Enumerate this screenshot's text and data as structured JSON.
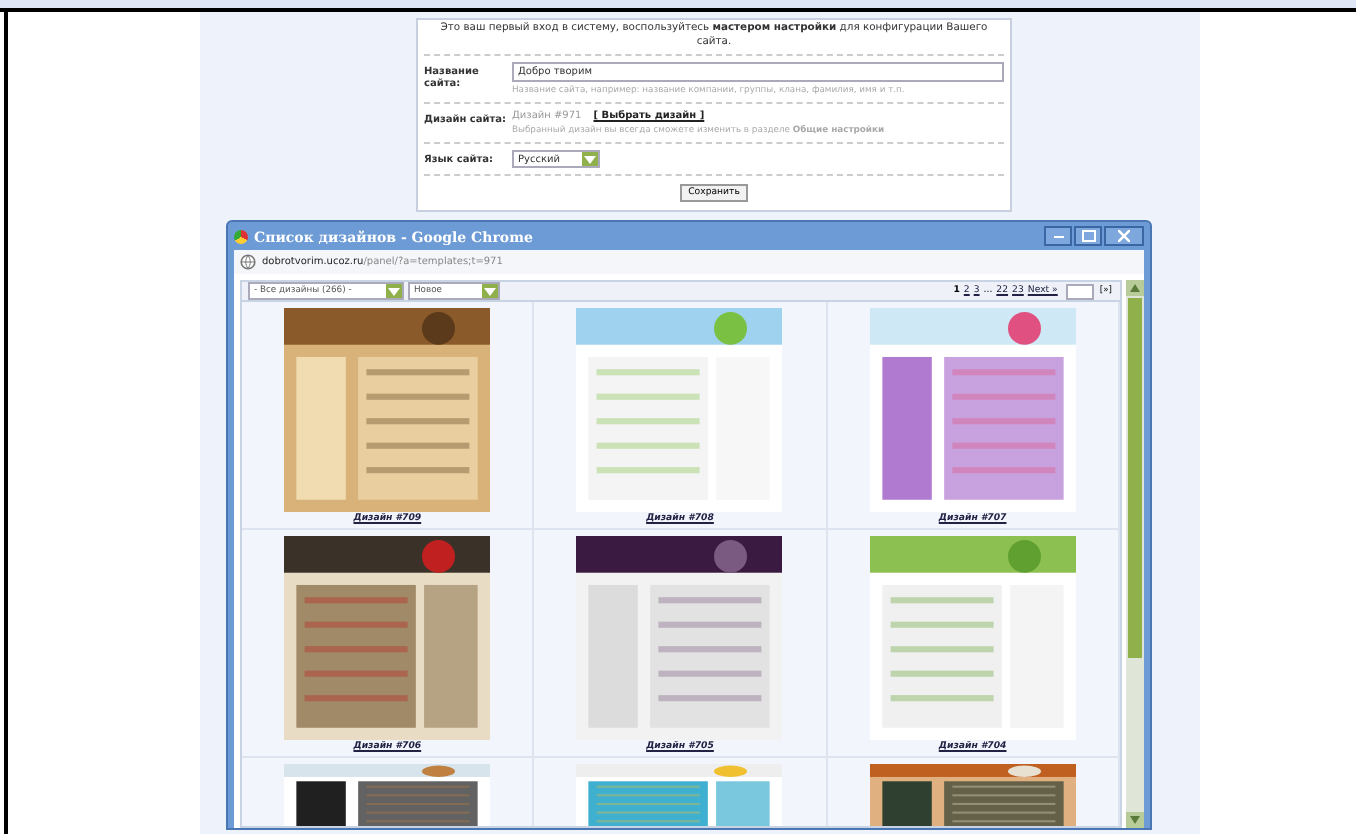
{
  "setup_form": {
    "intro": "Это ваш первый вход в систему, воспользуйтесь **мастером настройки** для конфигурации Вашего сайта.",
    "fields": [
      {
        "kind": "text",
        "label": "Название сайта:",
        "value": "Добро творим",
        "hint": "Название сайта, например: название компании, группы, клана, фамилия, имя и т.п."
      },
      {
        "kind": "design",
        "label": "Дизайн сайта:",
        "value": "Дизайн #971",
        "link": "[ Выбрать дизайн ]",
        "hint": "Выбранный дизайн вы всегда сможете изменить в разделе **Общие настройки**"
      },
      {
        "kind": "select",
        "label": "Язык сайта:",
        "value": "Русский"
      }
    ],
    "button": "Сохранить"
  },
  "popup": {
    "title": "Список дизайнов - Google Chrome",
    "url_host": "dobrotvorim.ucoz.ru",
    "url_path": "/panel/?a=templates;t=971",
    "filters": [
      {
        "value": "- Все дизайны (266) -"
      },
      {
        "value": "Новое"
      }
    ],
    "pages": [
      "1",
      "2",
      "3",
      "...",
      "22",
      "23",
      "Next »"
    ],
    "go_button": "[»]",
    "designs": [
      {
        "caption": "Дизайн #709"
      },
      {
        "caption": "Дизайн #708"
      },
      {
        "caption": "Дизайн #707"
      },
      {
        "caption": "Дизайн #706"
      },
      {
        "caption": "Дизайн #705"
      },
      {
        "caption": "Дизайн #704"
      }
    ]
  }
}
